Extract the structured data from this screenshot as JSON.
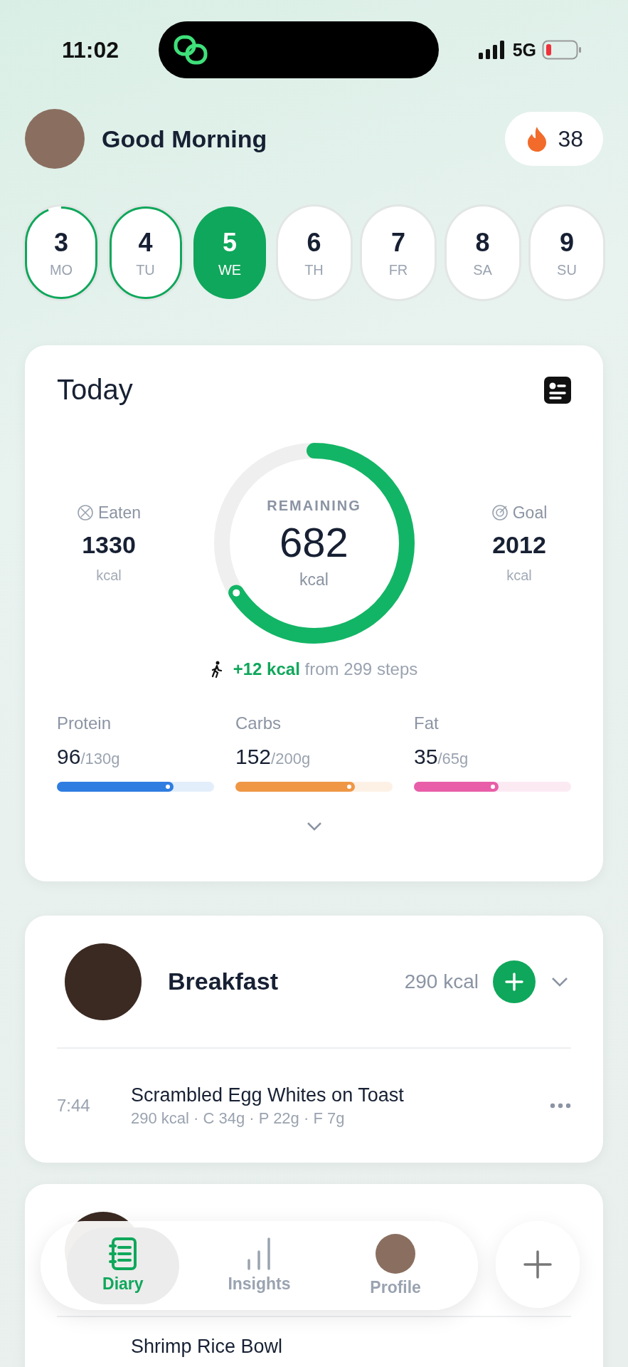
{
  "status_bar": {
    "time": "11:02",
    "network": "5G"
  },
  "header": {
    "greeting": "Good Morning",
    "streak": "38"
  },
  "days": [
    {
      "number": "3",
      "label": "MO",
      "selected": false,
      "level": 0.95
    },
    {
      "number": "4",
      "label": "TU",
      "selected": false,
      "level": 1
    },
    {
      "number": "5",
      "label": "WE",
      "selected": true
    },
    {
      "number": "6",
      "label": "TH",
      "selected": false
    },
    {
      "number": "7",
      "label": "FR",
      "selected": false
    },
    {
      "number": "8",
      "label": "SA",
      "selected": false
    },
    {
      "number": "9",
      "label": "SU",
      "selected": false
    }
  ],
  "today": {
    "title": "Today",
    "eaten": {
      "label": "Eaten",
      "value": "1330",
      "unit": "kcal"
    },
    "remaining": {
      "label": "REMAINING",
      "value": "682",
      "unit": "kcal",
      "level": 0.66
    },
    "goal": {
      "label": "Goal",
      "value": "2012",
      "unit": "kcal"
    },
    "steps": "**+12 kcal** from 299 steps",
    "macros": [
      {
        "name": "Protein",
        "amount": "96",
        "target": "/130g",
        "level": 0.74,
        "color": "#2f7de1"
      },
      {
        "name": "Carbs",
        "amount": "152",
        "target": "/200g",
        "level": 0.76,
        "color": "#ef9745"
      },
      {
        "name": "Fat",
        "amount": "35",
        "target": "/65g",
        "level": 0.54,
        "color": "#e85ea8"
      }
    ]
  },
  "meals": [
    {
      "name": "Breakfast",
      "kcal": "290 kcal",
      "entries": [
        {
          "time": "7:44",
          "name": "Scrambled Egg Whites on Toast",
          "detail": "290 kcal · C 34g · P 22g · F 7g"
        }
      ]
    },
    {
      "entries": [
        {
          "name": "Shrimp Rice Bowl"
        }
      ]
    }
  ],
  "nav": [
    {
      "kind": "diary",
      "label": "Diary",
      "selected": true
    },
    {
      "kind": "insights",
      "label": "Insights",
      "selected": false
    },
    {
      "kind": "profile",
      "label": "Profile",
      "selected": false
    }
  ]
}
